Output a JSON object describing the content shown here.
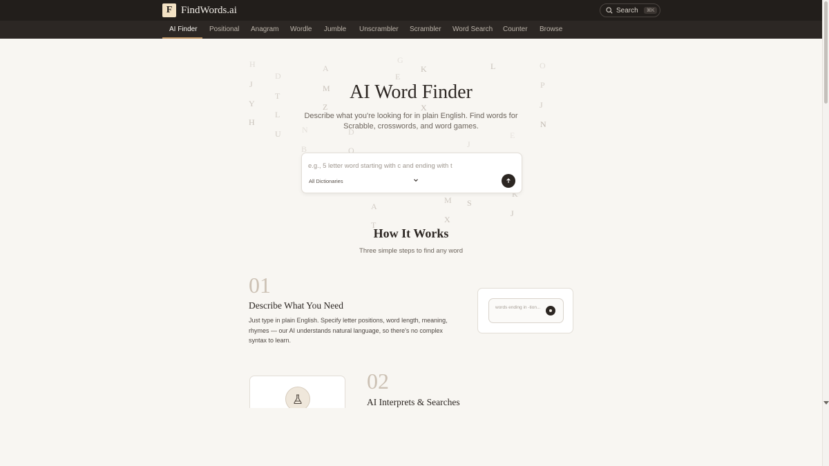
{
  "brand": {
    "logo_letter": "F",
    "name": "FindWords.ai"
  },
  "search": {
    "label": "Search",
    "shortcut": "⌘K",
    "icon": "search-icon"
  },
  "nav": {
    "items": [
      {
        "label": "AI Finder",
        "active": true
      },
      {
        "label": "Positional"
      },
      {
        "label": "Anagram"
      },
      {
        "label": "Wordle"
      },
      {
        "label": "Jumble"
      },
      {
        "label": "Unscrambler"
      },
      {
        "label": "Scrambler"
      },
      {
        "label": "Word Search"
      },
      {
        "label": "Counter"
      },
      {
        "label": "Browse"
      }
    ]
  },
  "hero": {
    "title": "AI Word Finder",
    "subtitle": "Describe what you're looking for in plain English. Find words for Scrabble, crosswords, and word games.",
    "input_placeholder": "e.g., 5 letter word starting with c and ending with t",
    "dictionary": "All Dictionaries"
  },
  "floating_letters": [
    "H",
    "D",
    "A",
    "G",
    "K",
    "L",
    "O",
    "J",
    "M",
    "E",
    "P",
    "T",
    "Y",
    "Z",
    "X",
    "J",
    "L",
    "N",
    "H",
    "U",
    "N",
    "D",
    "B",
    "O",
    "J",
    "A",
    "M",
    "S",
    "K",
    "J",
    "T",
    "X",
    "E"
  ],
  "how": {
    "title": "How It Works",
    "subtitle": "Three simple steps to find any word"
  },
  "steps": [
    {
      "number": "01",
      "title": "Describe What You Need",
      "description": "Just type in plain English. Specify letter positions, word length, meaning, rhymes — our AI understands natural language, so there's no complex syntax to learn.",
      "demo_text": "words ending in -tion..."
    },
    {
      "number": "02",
      "title": "AI Interprets & Searches",
      "icon": "flask-icon"
    }
  ],
  "colors": {
    "topbar": "#221e1b",
    "navbar": "#2c2724",
    "accent": "#b88f5f",
    "background": "#f8f6f2"
  }
}
